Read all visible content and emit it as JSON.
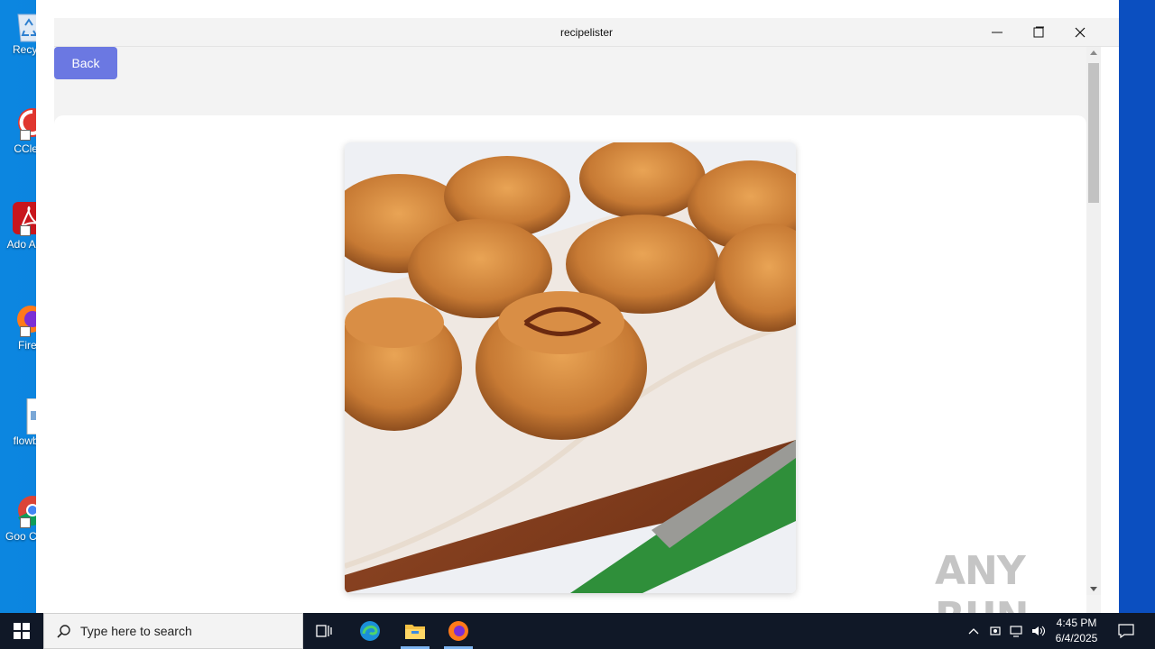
{
  "desktop": {
    "icons": [
      {
        "label": "Recycl",
        "icon": "recycle-bin-icon"
      },
      {
        "label": "CClea",
        "icon": "ccleaner-icon"
      },
      {
        "label": "Ado Acro",
        "icon": "adobe-acrobat-icon"
      },
      {
        "label": "Firef",
        "icon": "firefox-icon"
      },
      {
        "label": "flowbo",
        "icon": "image-file-icon"
      },
      {
        "label": "Goo Chro",
        "icon": "chrome-icon"
      }
    ]
  },
  "window": {
    "title": "recipelister",
    "controls": {
      "minimize": "—",
      "maximize": "☐",
      "close": "✕"
    }
  },
  "app": {
    "back_label": "Back",
    "recipe_image": {
      "alt": "Spiral pinwheel rolls on a wooden tray with a knife",
      "icon": "food-photo"
    }
  },
  "watermark": {
    "text": "ANY RUN"
  },
  "taskbar": {
    "search_placeholder": "Type here to search",
    "apps": [
      "task-view-icon",
      "edge-icon",
      "file-explorer-icon",
      "firefox-icon"
    ],
    "time": "4:45 PM",
    "date": "6/4/2025"
  },
  "colors": {
    "accent_button": "#6b78e2",
    "desktop": "#0a78d7",
    "taskbar": "#101827"
  }
}
